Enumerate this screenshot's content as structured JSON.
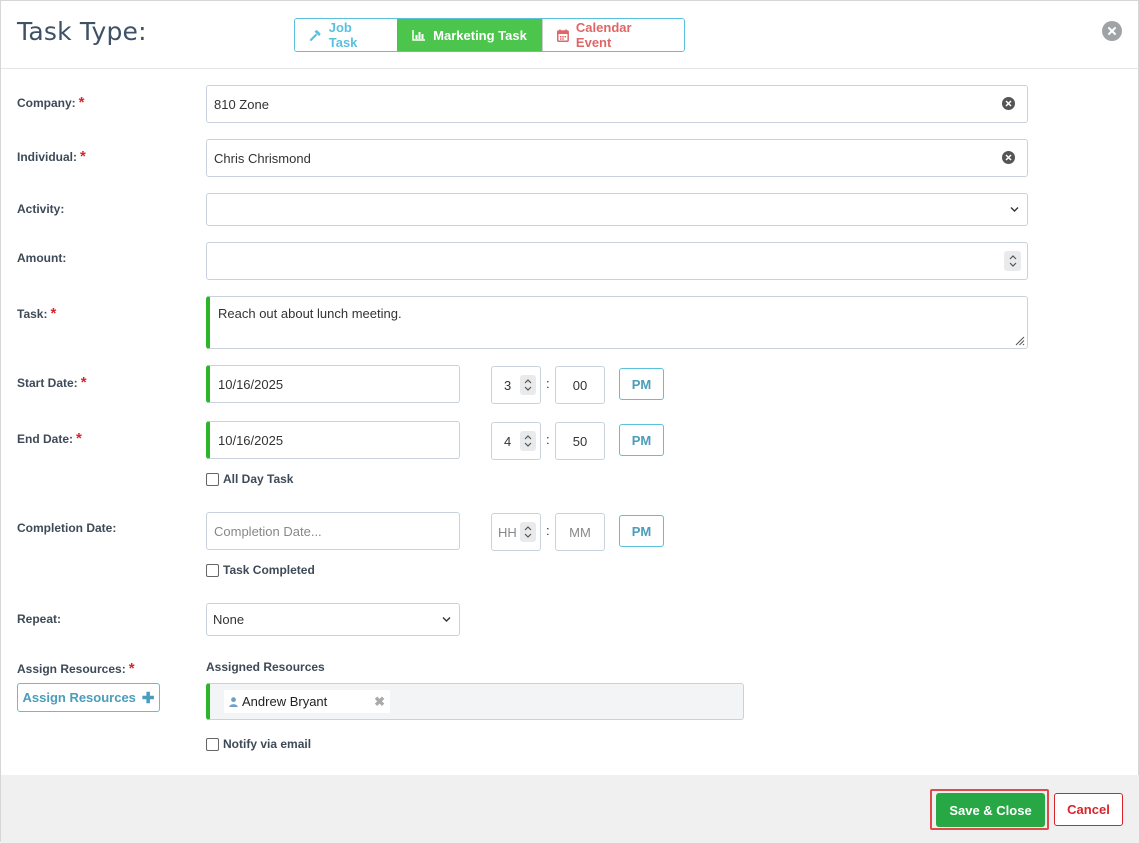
{
  "header": {
    "title": "Task Type:",
    "task_types": [
      {
        "label": "Job Task",
        "icon": "hammer-icon",
        "color": "#5bc0de"
      },
      {
        "label": "Marketing Task",
        "icon": "bar-chart-icon",
        "selected": true,
        "color": "#4cc54c"
      },
      {
        "label": "Calendar Event",
        "icon": "calendar-icon",
        "color": "#e06666"
      }
    ]
  },
  "form": {
    "company": {
      "label": "Company:",
      "required": "*",
      "value": "810 Zone"
    },
    "individual": {
      "label": "Individual:",
      "required": "*",
      "value": "Chris Chrismond"
    },
    "activity": {
      "label": "Activity:",
      "value": ""
    },
    "amount": {
      "label": "Amount:",
      "value": ""
    },
    "task": {
      "label": "Task:",
      "required": "*",
      "value": "Reach out about lunch meeting."
    },
    "start_date": {
      "label": "Start Date:",
      "required": "*",
      "date": "10/16/2025",
      "hour": "3",
      "minute": "00",
      "ampm": "PM"
    },
    "end_date": {
      "label": "End Date:",
      "required": "*",
      "date": "10/16/2025",
      "hour": "4",
      "minute": "50",
      "ampm": "PM"
    },
    "all_day": {
      "label": "All Day Task",
      "checked": false
    },
    "completion_date": {
      "label": "Completion Date:",
      "placeholder": "Completion Date...",
      "hour_placeholder": "HH",
      "minute_placeholder": "MM",
      "ampm": "PM"
    },
    "task_completed": {
      "label": "Task Completed",
      "checked": false
    },
    "repeat": {
      "label": "Repeat:",
      "value": "None"
    },
    "assign_resources": {
      "label": "Assign Resources:",
      "required": "*",
      "button_label": "Assign Resources",
      "assigned_label": "Assigned Resources",
      "assigned": [
        "Andrew Bryant"
      ]
    },
    "notify": {
      "label": "Notify via email",
      "checked": false
    }
  },
  "footer": {
    "save_label": "Save & Close",
    "cancel_label": "Cancel"
  },
  "colors": {
    "accent_green": "#28a745",
    "required_red": "#d9242b",
    "info_blue": "#5bc0de"
  }
}
